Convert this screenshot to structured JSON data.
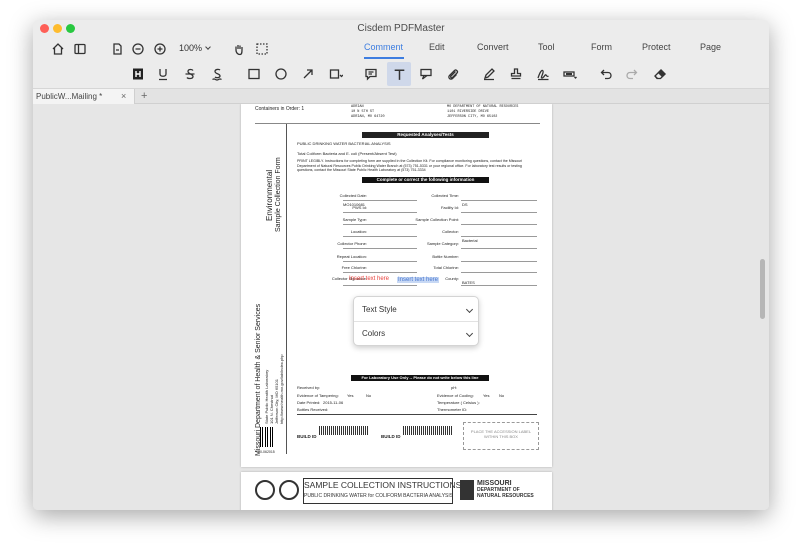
{
  "window": {
    "title": "Cisdem PDFMaster"
  },
  "toolbar": {
    "zoom": "100%",
    "menu": [
      "Comment",
      "Edit",
      "Convert",
      "Tool",
      "Form",
      "Protect",
      "Page"
    ],
    "active_menu": "Comment"
  },
  "tab": {
    "label": "PublicW...Mailing *",
    "close": "×",
    "add": "+"
  },
  "doc": {
    "containers": "Containers in Order: 1",
    "addr_left": [
      "ADRIAN",
      "10 N 5TH ST",
      "ADRIAN, MO 64720"
    ],
    "addr_right": [
      "MO DEPARTMENT OF NATURAL RESOURCES",
      "1101 RIVERSIDE DRIVE",
      "JEFFERSON CITY, MO 65102"
    ],
    "requested": "Requested Analyses/Tests",
    "analysis": "PUBLIC DRINKING WATER BACTERIAL ANALYSIS",
    "coliform": "Total Coliform Bacteria and E. coli (Present/Absent Test)",
    "print_legibly": "PRINT LEGIBLY. Instructions for completing form are supplied in the Collection Kit. For compliance monitoring questions, contact the Missouri Department of Natural Resources Public Drinking Water Branch at (573) 751-5331 or your regional office. For laboratory test results or testing questions, contact the Missouri State Public Health Laboratory at (573) 751-3334",
    "complete": "Complete or correct the following information",
    "side_env": "Environmental",
    "side_form": "Sample Collection Form",
    "labels_left": [
      "Collected Date:",
      "PWS Id:",
      "Sample Type:",
      "Location:",
      "Collector Phone:",
      "Repeat Location:",
      "Free Chlorine:",
      "Collector Signature:"
    ],
    "labels_right": [
      "Collected Time:",
      "Facility Id:",
      "Sample Collection Point:",
      "Collector:",
      "Sample Category:",
      "Bottle Number:",
      "Total Chlorine:",
      "County:"
    ],
    "pws_value": "MO1010681",
    "facility_value": "DS",
    "category_value": "Bacterial",
    "county_value": "BATES",
    "insert_text_red": "Insert text here",
    "insert_text_blue": "Insert text here",
    "popup_text_style": "Text Style",
    "popup_colors": "Colors",
    "side_dept": "Missouri Department of Health & Senior Services",
    "side_lab": "State Public Health Laboratory",
    "side_addr1": "101 N. Chestnut",
    "side_addr2": "Jefferson City, MO 65101",
    "side_web": "http://www.health.mo.gov/lab/index.php",
    "lab_use": "For Laboratory Use Only -- Please do not write below this line",
    "received_by": "Received by:",
    "ph": "pH:",
    "evidence_tampering": "Evidence of Tampering:",
    "yes": "Yes",
    "no": "No",
    "evidence_cooling": "Evidence of Cooling:",
    "date_printed": "Date Printed:",
    "date_printed_value": "2015-11-06",
    "temperature": "Temperature ( Celsius ):",
    "bottles_received": "Bottles Received:",
    "thermometer": "Thermometer ID:",
    "build_id": "BUILD ID",
    "accession": "PLACE THE ACCESSION LABEL WITHIN THIS BOX",
    "barcode_num": "00-062015"
  },
  "page2": {
    "title": "SAMPLE COLLECTION INSTRUCTIONS",
    "subtitle": "PUBLIC DRINKING WATER for COLIFORM BACTERIA ANALYSIS",
    "logo_right_1": "MISSOURI",
    "logo_right_2": "DEPARTMENT OF",
    "logo_right_3": "NATURAL RESOURCES"
  }
}
